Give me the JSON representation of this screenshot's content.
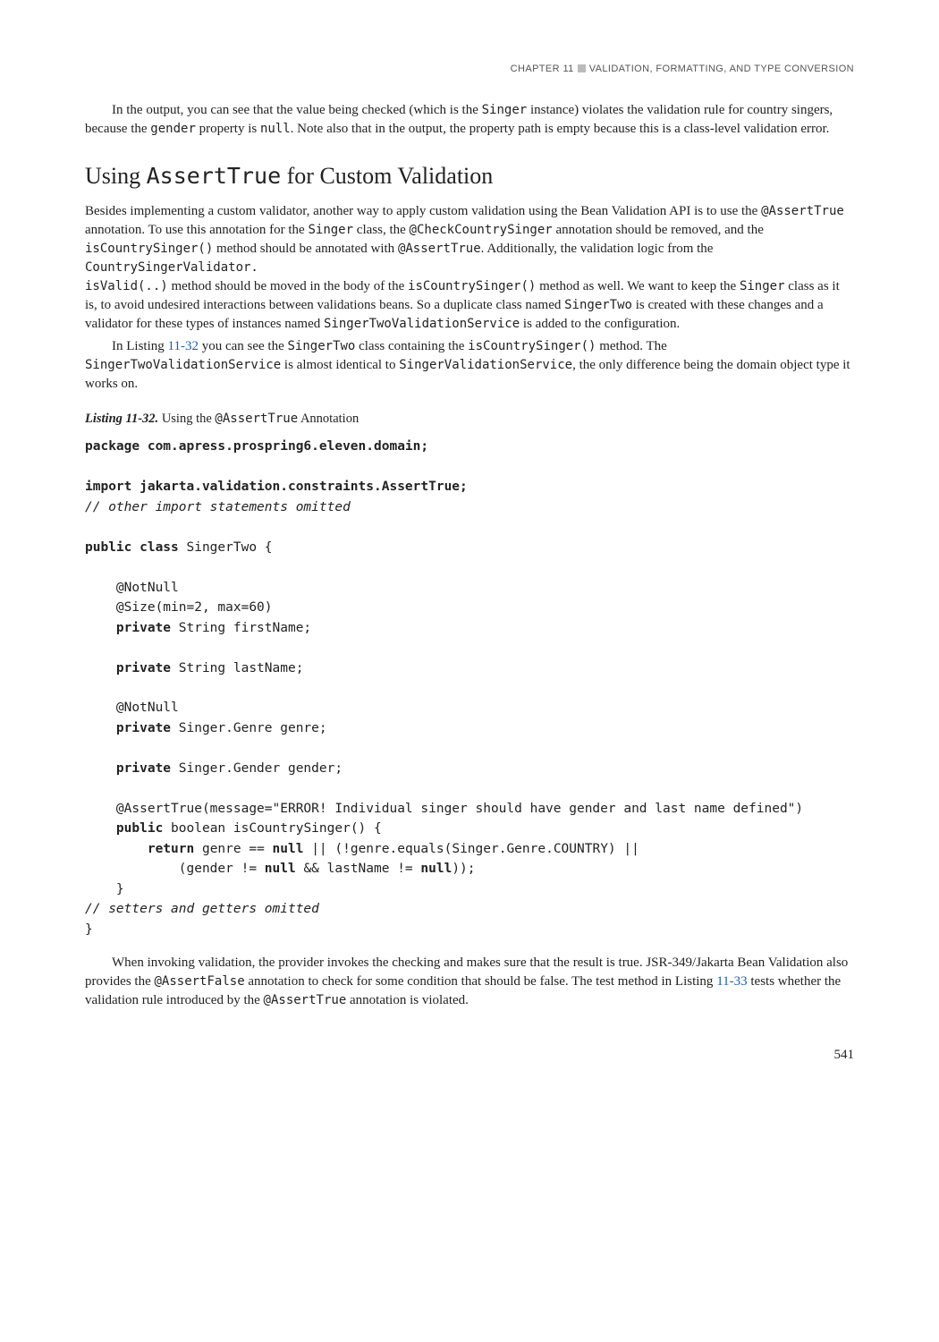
{
  "header": {
    "chapter": "CHAPTER 11",
    "title": "VALIDATION, FORMATTING, AND TYPE CONVERSION"
  },
  "p1a": "In the output, you can see that the value being checked (which is the ",
  "p1b": "Singer",
  "p1c": " instance) violates the validation rule for country singers, because the ",
  "p1d": "gender",
  "p1e": " property is ",
  "p1f": "null",
  "p1g": ". Note also that in the output, the property path is empty because this is a class-level validation error.",
  "h2a": "Using ",
  "h2b": "AssertTrue",
  "h2c": " for Custom Validation",
  "p2a": "Besides implementing a custom validator, another way to apply custom validation using the Bean Validation API is to use the ",
  "p2_assert": "@AssertTrue",
  "p2b": " annotation. To use this annotation for the ",
  "p2_singer": "Singer",
  "p2c": " class, the ",
  "p2_check": "@CheckCountrySinger",
  "p2d": " annotation should be removed, and the ",
  "p2_iscs": "isCountrySinger()",
  "p2e": " method should be annotated with ",
  "p2f": ". Additionally, the validation logic from the ",
  "p2_csv": "CountrySingerValidator.",
  "p2_isvalid": "isValid(..)",
  "p2g": " method should be moved in the body of the ",
  "p2h": " method as well. We want to keep the ",
  "p2i": " class as it is, to avoid undesired interactions between validations beans. So a duplicate class named ",
  "p2_two": "SingerTwo",
  "p2j": " is created with these changes and a validator for these types of instances named ",
  "p2_svc": "SingerTwoValidationService",
  "p2k": " is added to the configuration.",
  "p3a": "In Listing ",
  "p3_link": "11-32",
  "p3b": " you can see the ",
  "p3c": " class containing the ",
  "p3d": " method. The ",
  "p3e": " is almost identical to ",
  "p3_svs": "SingerValidationService",
  "p3f": ", the only difference being the domain object type it works on.",
  "listing": {
    "label": "Listing 11-32.",
    "caption_a": "Using the ",
    "caption_b": "@AssertTrue",
    "caption_c": " Annotation"
  },
  "code": {
    "l1": "package com.apress.prospring6.eleven.domain;",
    "l2": "import jakarta.validation.constraints.AssertTrue;",
    "l3": "// other import statements omitted",
    "l4a": "public class",
    "l4b": " SingerTwo {",
    "l5": "    @NotNull",
    "l6": "    @Size(min=2, max=60)",
    "l7a": "    ",
    "l7b": "private",
    "l7c": " String firstName;",
    "l8a": "    ",
    "l8b": "private",
    "l8c": " String lastName;",
    "l9": "    @NotNull",
    "l10a": "    ",
    "l10b": "private",
    "l10c": " Singer.Genre genre;",
    "l11a": "    ",
    "l11b": "private",
    "l11c": " Singer.Gender gender;",
    "l12": "    @AssertTrue(message=\"ERROR! Individual singer should have gender and last name defined\")",
    "l13a": "    ",
    "l13b": "public",
    "l13c": " boolean isCountrySinger() {",
    "l14a": "        ",
    "l14b": "return",
    "l14c": " genre == ",
    "l14d": "null",
    "l14e": " || (!genre.equals(Singer.Genre.COUNTRY) ||",
    "l15a": "            (gender != ",
    "l15b": "null",
    "l15c": " && lastName != ",
    "l15d": "null",
    "l15e": "));",
    "l16": "    }",
    "l17": "// setters and getters omitted",
    "l18": "}"
  },
  "p4a": "When invoking validation, the provider invokes the checking and makes sure that the result is true. JSR-349/Jakarta Bean Validation also provides the ",
  "p4_af": "@AssertFalse",
  "p4b": " annotation to check for some condition that should be false. The test method in Listing ",
  "p4_link": "11-33",
  "p4c": " tests whether the validation rule introduced by the ",
  "p4d": " annotation is violated.",
  "pagenum": "541"
}
